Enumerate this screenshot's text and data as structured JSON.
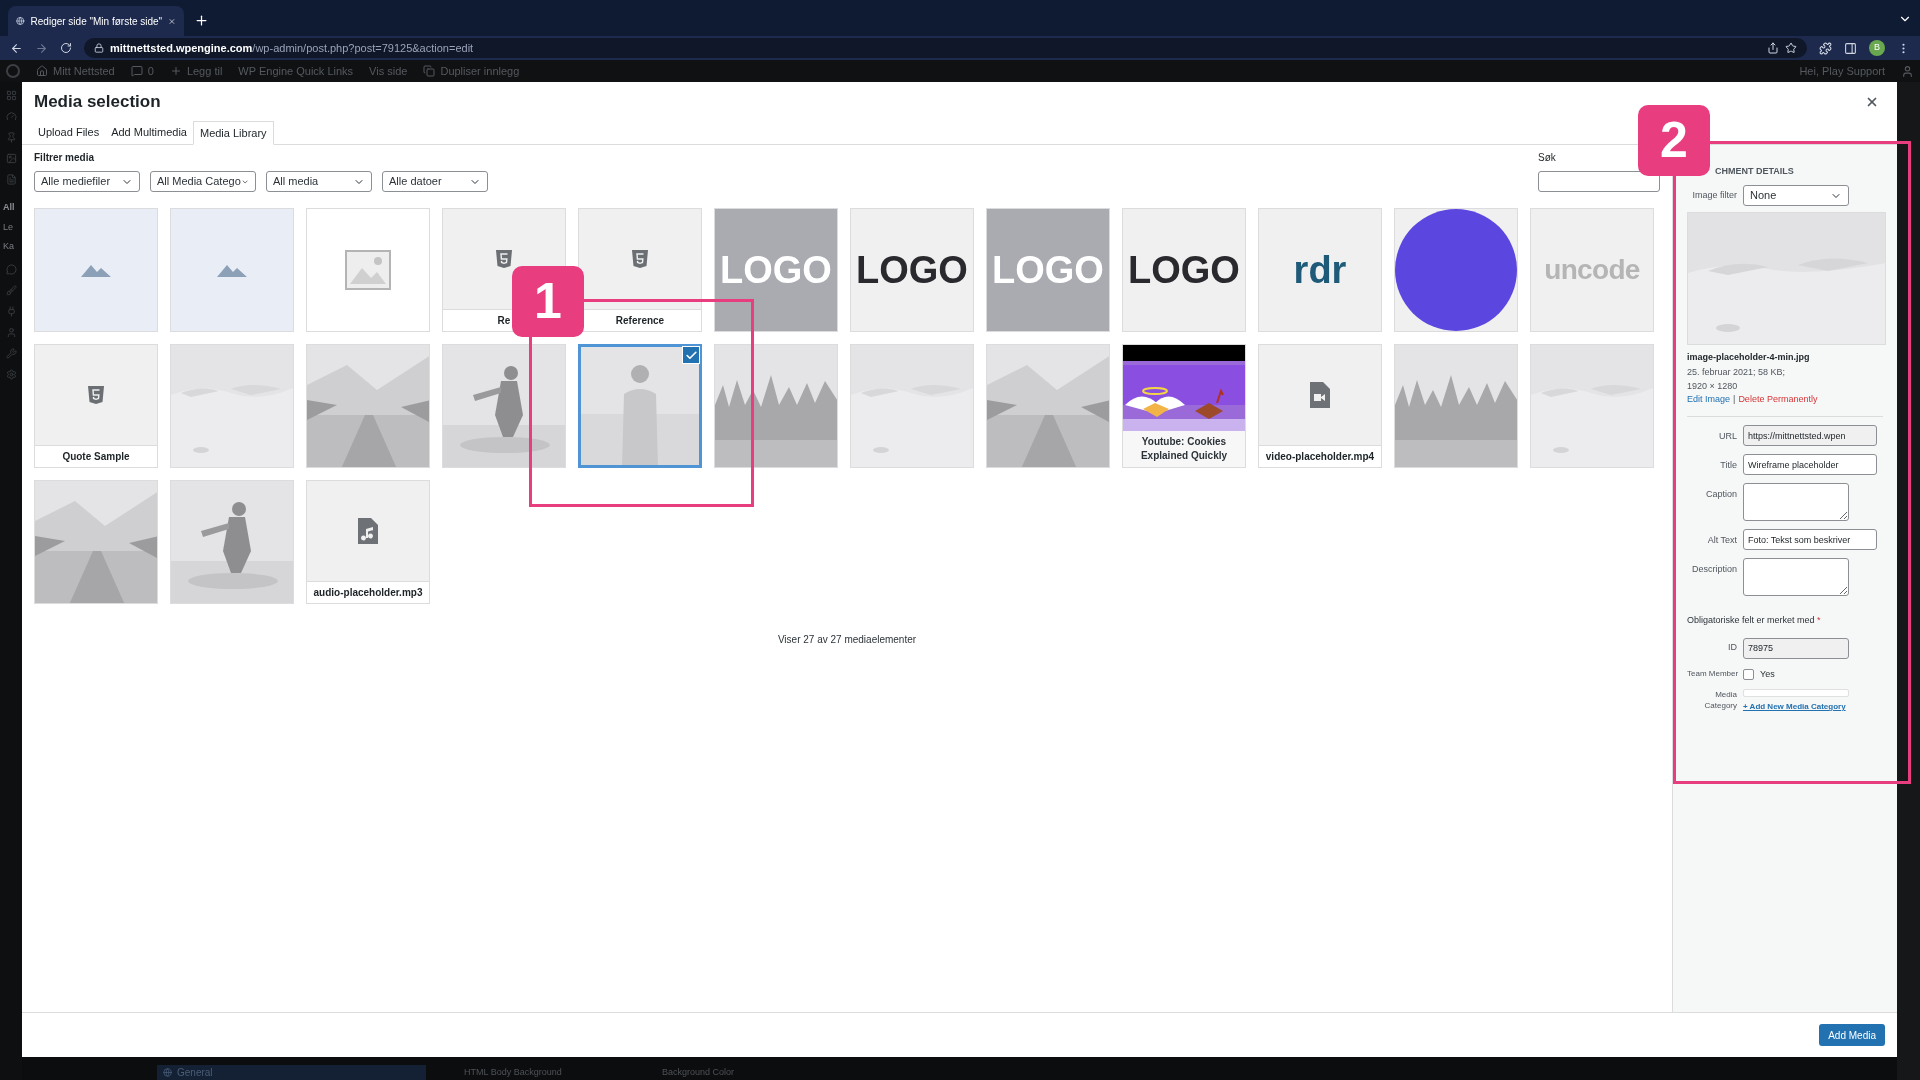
{
  "browser": {
    "tab_title": "Rediger side \"Min første side\"",
    "url_domain": "mittnettsted.wpengine.com",
    "url_path": "/wp-admin/post.php?post=79125&action=edit",
    "profile_initial": "B"
  },
  "admin_bar": {
    "items": [
      {
        "label": "Mitt Nettsted",
        "kind": "home"
      },
      {
        "label": "0",
        "kind": "comments"
      },
      {
        "label": "Legg til",
        "kind": "add"
      },
      {
        "label": "WP Engine Quick Links",
        "kind": "plain"
      },
      {
        "label": "Vis side",
        "kind": "plain"
      },
      {
        "label": "Dupliser innlegg",
        "kind": "copy"
      }
    ],
    "greeting": "Hei, Play Support"
  },
  "sidebar_texts": [
    "All",
    "Le",
    "Ka"
  ],
  "modal": {
    "title": "Media selection",
    "tabs": [
      {
        "label": "Upload Files",
        "selected": false
      },
      {
        "label": "Add Multimedia",
        "selected": false
      },
      {
        "label": "Media Library",
        "selected": true
      }
    ],
    "filter_label": "Filtrer media",
    "filters": [
      "Alle mediefiler",
      "All Media Catego",
      "All media",
      "Alle datoer"
    ],
    "search_label": "Søk",
    "tiles": [
      {
        "kind": "placeholder",
        "selected": false
      },
      {
        "kind": "placeholder",
        "selected": false
      },
      {
        "kind": "image-icon",
        "selected": false
      },
      {
        "kind": "document",
        "label": "Re",
        "selected": false
      },
      {
        "kind": "document",
        "label": "Reference",
        "selected": false
      },
      {
        "kind": "wordmark",
        "text": "LOGO",
        "color": "#ffffff",
        "selected": false
      },
      {
        "kind": "wordmark",
        "text": "LOGO",
        "color": "#2a2a2e",
        "selected": false
      },
      {
        "kind": "wordmark",
        "text": "LOGO",
        "color": "#ffffff",
        "selected": false
      },
      {
        "kind": "wordmark",
        "text": "LOGO",
        "color": "#2a2a2e",
        "selected": false
      },
      {
        "kind": "wordmark",
        "text": "rdr",
        "color": "#1f5a78",
        "selected": false
      },
      {
        "kind": "circle",
        "color": "#5b47e0",
        "selected": false
      },
      {
        "kind": "wordmark",
        "text": "uncode",
        "color": "#b5b5b5",
        "selected": false
      },
      {
        "kind": "document",
        "label": "Quote Sample",
        "selected": false
      },
      {
        "kind": "picture",
        "selected": false
      },
      {
        "kind": "picture",
        "selected": false
      },
      {
        "kind": "picture",
        "selected": false
      },
      {
        "kind": "picture",
        "selected": true
      },
      {
        "kind": "picture",
        "selected": false
      },
      {
        "kind": "picture",
        "selected": false
      },
      {
        "kind": "picture",
        "selected": false
      },
      {
        "kind": "video-thumb",
        "label": "Youtube: Cookies Explained Quickly",
        "selected": false
      },
      {
        "kind": "video-file",
        "label": "video-placeholder.mp4",
        "selected": false
      },
      {
        "kind": "picture",
        "selected": false
      },
      {
        "kind": "picture",
        "selected": false
      },
      {
        "kind": "picture",
        "selected": false
      },
      {
        "kind": "picture",
        "selected": false
      },
      {
        "kind": "audio-file",
        "label": "audio-placeholder.mp3",
        "selected": false
      }
    ],
    "status": "Viser 27 av 27 mediaelementer",
    "details": {
      "heading": "CHMENT DETAILS",
      "image_filter": {
        "label": "Image filter",
        "value": "None"
      },
      "filename": "image-placeholder-4-min.jpg",
      "meta": "25. februar 2021; 58 KB; 1920 × 1280",
      "edit_link": "Edit Image",
      "separator": "|",
      "delete_link": "Delete Permanently",
      "fields": [
        {
          "label": "URL",
          "kind": "input",
          "value": "https://mittnettsted.wpen",
          "readonly": true
        },
        {
          "label": "Title",
          "kind": "input",
          "value": "Wireframe placeholder",
          "readonly": false
        },
        {
          "label": "Caption",
          "kind": "textarea",
          "readonly": false
        },
        {
          "label": "Alt Text",
          "kind": "input",
          "value": "Foto: Tekst som beskriver",
          "readonly": false
        },
        {
          "label": "Description",
          "kind": "textarea",
          "readonly": false
        }
      ],
      "required_note": "Obligatoriske felt er merket med",
      "required_mark": "*",
      "id_field": {
        "label": "ID",
        "value": "78975",
        "readonly": true
      },
      "team": {
        "label": "Team Member",
        "option": "Yes",
        "checked": false
      },
      "category": {
        "label": "Media Category",
        "link": "+ Add New Media Category"
      }
    },
    "footer_button": "Add Media"
  },
  "background_texts": [
    "General",
    "HTML Body Background",
    "Background Color"
  ],
  "annotations": [
    {
      "label": "1"
    },
    {
      "label": "2"
    }
  ]
}
